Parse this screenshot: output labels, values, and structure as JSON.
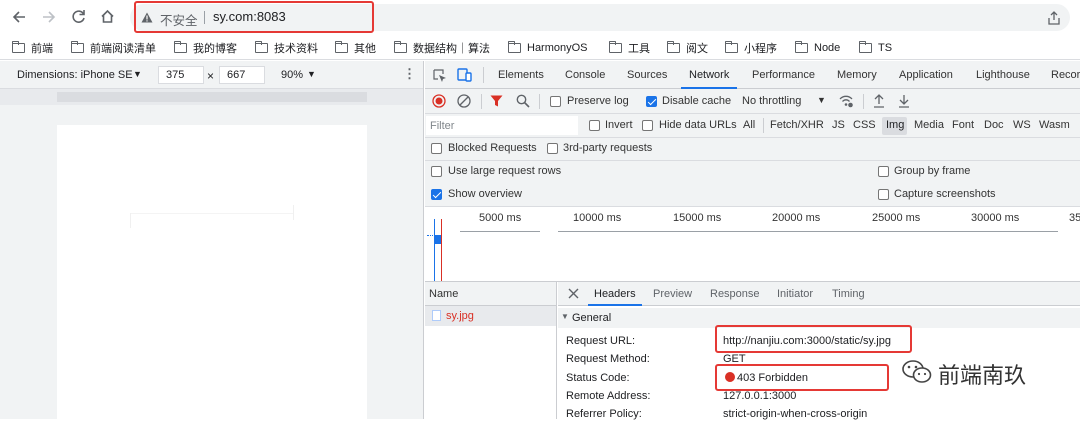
{
  "browser": {
    "security_label": "不安全",
    "url": "sy.com:8083"
  },
  "bookmarks": [
    "前端",
    "前端阅读清单",
    "我的博客",
    "技术资料",
    "其他",
    "数据结构｜算法",
    "HarmonyOS",
    "工具",
    "阅文",
    "小程序",
    "Node",
    "TS"
  ],
  "device_toolbar": {
    "dimensions_label": "Dimensions: iPhone SE",
    "width": "375",
    "times": "×",
    "height": "667",
    "zoom": "90%"
  },
  "devtools": {
    "tabs": [
      "Elements",
      "Console",
      "Sources",
      "Network",
      "Performance",
      "Memory",
      "Application",
      "Lighthouse",
      "Recor"
    ],
    "active_tab": "Network"
  },
  "network_toolbar": {
    "preserve_log": "Preserve log",
    "disable_cache": "Disable cache",
    "throttling": "No throttling"
  },
  "filter_bar": {
    "placeholder": "Filter",
    "invert": "Invert",
    "hide_data_urls": "Hide data URLs",
    "types": [
      "All",
      "Fetch/XHR",
      "JS",
      "CSS",
      "Img",
      "Media",
      "Font",
      "Doc",
      "WS",
      "Wasm"
    ],
    "active_type": "Img"
  },
  "blocked_bar": {
    "blocked": "Blocked Requests",
    "third_party": "3rd-party requests"
  },
  "settings": {
    "large_rows": "Use large request rows",
    "group_by_frame": "Group by frame",
    "show_overview": "Show overview",
    "capture_screenshots": "Capture screenshots"
  },
  "timeline": {
    "ticks": [
      "5000 ms",
      "10000 ms",
      "15000 ms",
      "20000 ms",
      "25000 ms",
      "30000 ms",
      "35"
    ]
  },
  "request_list": {
    "header": "Name",
    "items": [
      "sy.jpg"
    ]
  },
  "detail_tabs": [
    "Headers",
    "Preview",
    "Response",
    "Initiator",
    "Timing"
  ],
  "general": {
    "title": "General",
    "rows": [
      {
        "label": "Request URL:",
        "value": "http://nanjiu.com:3000/static/sy.jpg"
      },
      {
        "label": "Request Method:",
        "value": "GET"
      },
      {
        "label": "Status Code:",
        "value": "403 Forbidden"
      },
      {
        "label": "Remote Address:",
        "value": "127.0.0.1:3000"
      },
      {
        "label": "Referrer Policy:",
        "value": "strict-origin-when-cross-origin"
      }
    ]
  },
  "watermark": "前端南玖",
  "colors": {
    "accent": "#1a73e8",
    "highlight_red": "#e53935",
    "status_red": "#d93025"
  }
}
